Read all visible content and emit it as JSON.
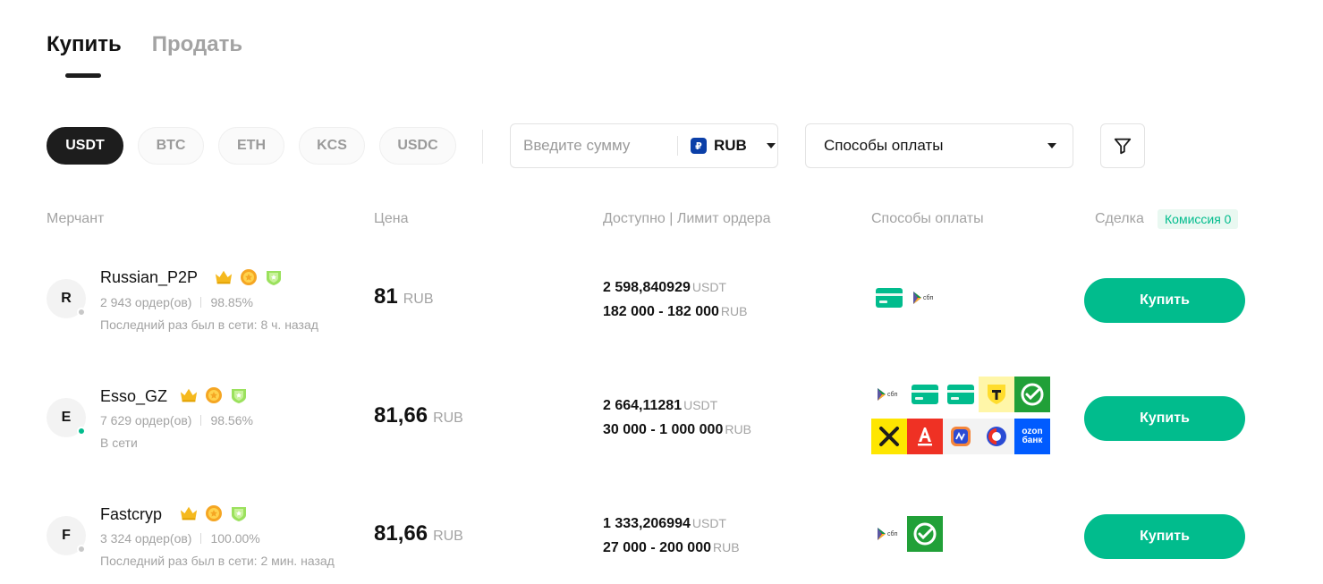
{
  "tabs": [
    {
      "label": "Купить",
      "active": true
    },
    {
      "label": "Продать",
      "active": false
    }
  ],
  "coins": [
    {
      "label": "USDT",
      "active": true
    },
    {
      "label": "BTC",
      "active": false
    },
    {
      "label": "ETH",
      "active": false
    },
    {
      "label": "KCS",
      "active": false
    },
    {
      "label": "USDC",
      "active": false
    }
  ],
  "amount": {
    "placeholder": "Введите сумму",
    "currency_symbol": "₽",
    "currency": "RUB"
  },
  "payment_filter": {
    "label": "Способы оплаты"
  },
  "table_header": {
    "merchant": "Мерчант",
    "price": "Цена",
    "available": "Доступно | Лимит ордера",
    "payment": "Способы оплаты",
    "deal": "Сделка",
    "commission": "Комиссия 0"
  },
  "rows": [
    {
      "avatar": "R",
      "name": "Russian_P2P",
      "orders": "2 943 ордер(ов)",
      "completion": "98.85%",
      "seen": "Последний раз был в сети: 8 ч. назад",
      "online": false,
      "price": "81",
      "price_unit": "RUB",
      "available": "2 598,840929",
      "available_unit": "USDT",
      "limit": "182 000 - 182 000",
      "limit_unit": "RUB",
      "payment_icons": [
        "card-icon",
        "sbp-icon"
      ],
      "action": "Купить"
    },
    {
      "avatar": "E",
      "name": "Esso_GZ",
      "orders": "7 629 ордер(ов)",
      "completion": "98.56%",
      "seen": "В сети",
      "online": true,
      "price": "81,66",
      "price_unit": "RUB",
      "available": "2 664,11281",
      "available_unit": "USDT",
      "limit": "30 000 - 1 000 000",
      "limit_unit": "RUB",
      "payment_icons": [
        "sbp-icon",
        "card-icon",
        "card-icon",
        "tbank-icon",
        "sber-icon",
        "raiffeisen-icon",
        "alfa-icon",
        "gazprom-icon",
        "pochta-icon",
        "ozon-icon"
      ],
      "ozon_label_top": "ozon",
      "ozon_label_bottom": "банк",
      "action": "Купить"
    },
    {
      "avatar": "F",
      "name": "Fastcryp",
      "orders": "3 324 ордер(ов)",
      "completion": "100.00%",
      "seen": "Последний раз был в сети: 2 мин. назад",
      "online": false,
      "price": "81,66",
      "price_unit": "RUB",
      "available": "1 333,206994",
      "available_unit": "USDT",
      "limit": "27 000 - 200 000",
      "limit_unit": "RUB",
      "payment_icons": [
        "sbp-icon",
        "sber-icon"
      ],
      "action": "Купить"
    }
  ],
  "colors": {
    "accent": "#01bc8d",
    "dark": "#1d1d1d",
    "muted": "#a3a3a3"
  }
}
